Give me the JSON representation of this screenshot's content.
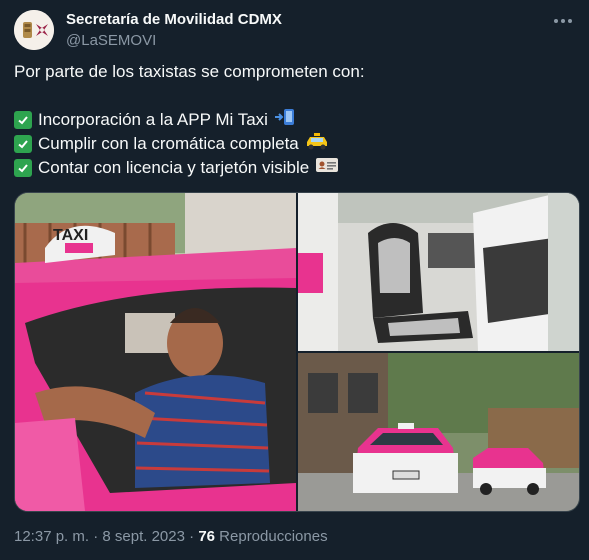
{
  "author": {
    "display_name": "Secretaría de Movilidad CDMX",
    "handle": "@LaSEMOVI"
  },
  "tweet": {
    "intro": "Por parte de los taxistas se comprometen con:",
    "items": [
      {
        "text": "Incorporación a la APP Mi Taxi",
        "emoji": "mobile-arrow-icon"
      },
      {
        "text": "Cumplir con la cromática completa",
        "emoji": "taxi-icon"
      },
      {
        "text": "Contar con licencia y tarjetón visible",
        "emoji": "id-card-icon"
      }
    ],
    "taxi_sign_text": "TAXI"
  },
  "meta": {
    "time": "12:37 p. m.",
    "separator_1": "·",
    "date": "8 sept. 2023",
    "separator_2": "·",
    "views": "76",
    "views_label": "Reproducciones"
  },
  "colors": {
    "background": "#15202b",
    "text": "#f7f9f9",
    "secondary_text": "#8b98a5",
    "taxi_pink": "#e8338f",
    "check_green": "#2ea44f"
  }
}
